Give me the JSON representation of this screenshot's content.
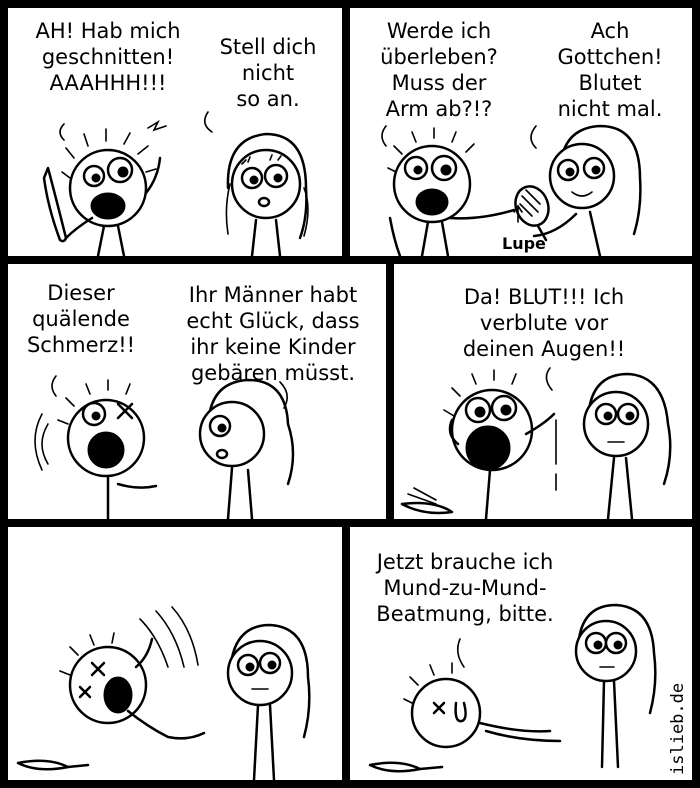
{
  "comic": {
    "credit": "islieb.de",
    "panels": [
      {
        "man": "AH! Hab mich\ngeschnitten!\nAAAHHH!!!",
        "woman": "Stell dich\nnicht\nso an."
      },
      {
        "man": "Werde ich\nüberleben?\nMuss der\nArm ab?!?",
        "woman": "Ach\nGottchen!\nBlutet\nnicht mal.",
        "label": "Lupe"
      },
      {
        "man": "Dieser\nquälende\nSchmerz!!",
        "woman": "Ihr Männer habt\necht Glück, dass\nihr keine Kinder\ngebären müsst."
      },
      {
        "man": "Da! BLUT!!! Ich\nverblute vor\ndeinen Augen!!"
      },
      {},
      {
        "man": "Jetzt brauche ich\nMund-zu-Mund-\nBeatmung, bitte."
      }
    ]
  }
}
